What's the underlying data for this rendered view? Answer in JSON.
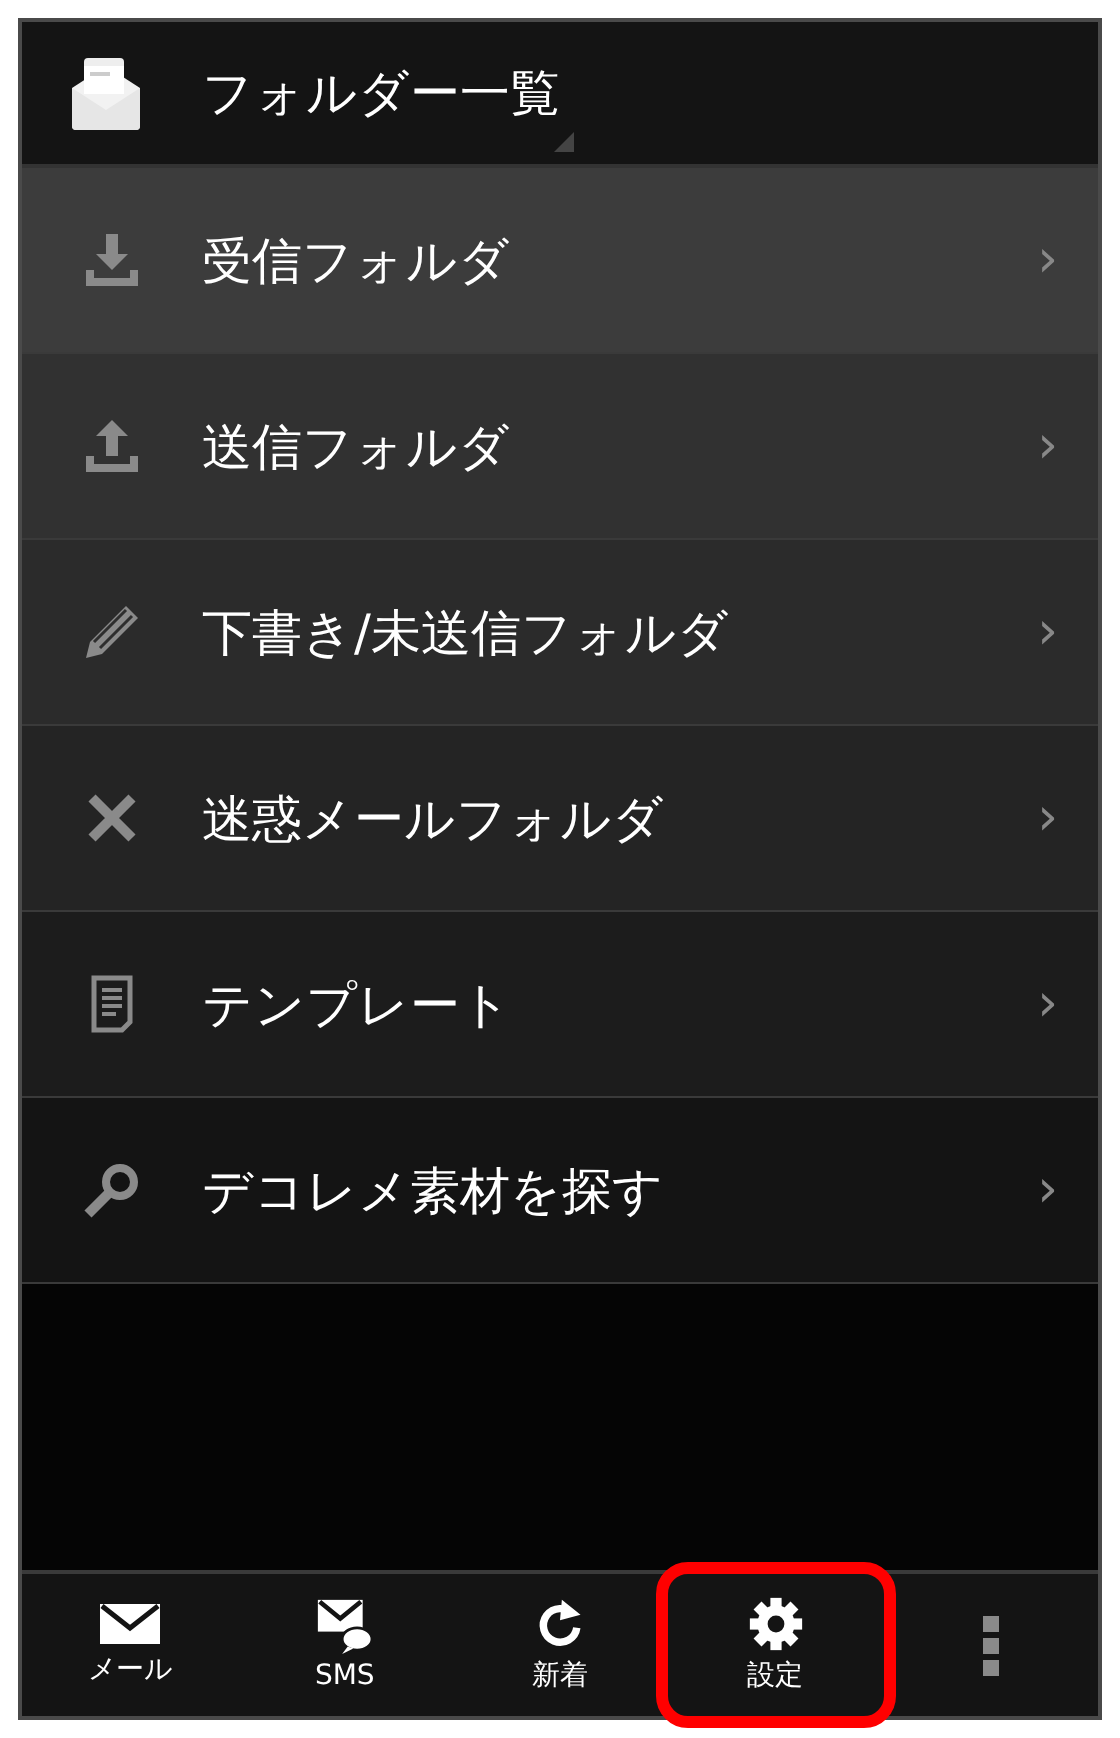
{
  "header": {
    "title": "フォルダー一覧"
  },
  "folders": [
    {
      "kind": "inbox",
      "label": "受信フォルダ",
      "chevron": "›"
    },
    {
      "kind": "outbox",
      "label": "送信フォルダ",
      "chevron": "›"
    },
    {
      "kind": "draft",
      "label": "下書き/未送信フォルダ",
      "chevron": "›"
    },
    {
      "kind": "spam",
      "label": "迷惑メールフォルダ",
      "chevron": "›"
    },
    {
      "kind": "template",
      "label": "テンプレート",
      "chevron": "›"
    },
    {
      "kind": "search",
      "label": "デコレメ素材を探す",
      "chevron": "›"
    }
  ],
  "bottom_bar": [
    {
      "kind": "mail",
      "label": "メール",
      "highlighted": false
    },
    {
      "kind": "sms",
      "label": "SMS",
      "highlighted": false
    },
    {
      "kind": "refresh",
      "label": "新着",
      "highlighted": false
    },
    {
      "kind": "settings",
      "label": "設定",
      "highlighted": true
    },
    {
      "kind": "more",
      "highlighted": false
    }
  ]
}
